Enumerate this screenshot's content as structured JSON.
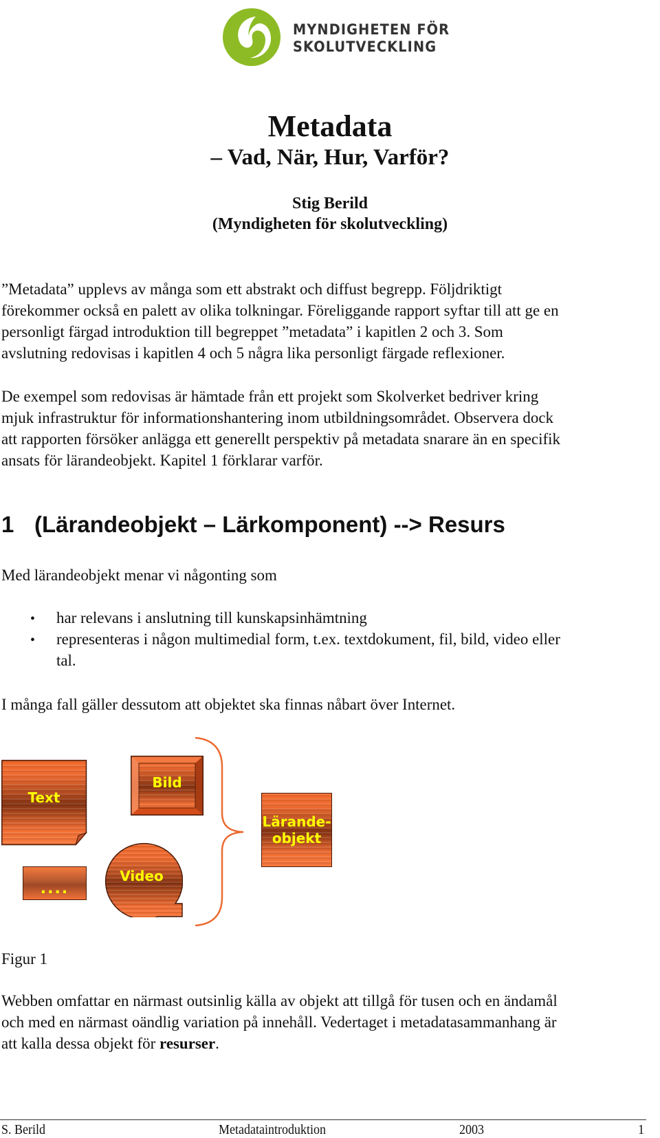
{
  "logo": {
    "icon": "swirl-logo-icon",
    "line1": "MYNDIGHETEN FÖR",
    "line2": "SKOLUTVECKLING",
    "color": "#8dbb25"
  },
  "header": {
    "title": "Metadata",
    "subtitle": "– Vad, När, Hur, Varför?",
    "author": "Stig Berild",
    "affiliation": "(Myndigheten för skolutveckling)"
  },
  "intro": {
    "paragraph1": [
      "”Metadata” upplevs av många som ett abstrakt och diffust begrepp. Följdriktigt",
      "förekommer också en palett av olika tolkningar. Föreliggande rapport syftar till att ge en",
      "personligt färgad introduktion till begreppet ”metadata” i kapitlen 2 och 3. Som",
      "avslutning redovisas i kapitlen 4 och 5 några lika personligt färgade reflexioner."
    ],
    "paragraph2": [
      "De exempel som redovisas är hämtade från ett projekt som Skolverket bedriver kring",
      "mjuk infrastruktur för informationshantering inom utbildningsområdet. Observera dock",
      "att rapporten försöker anlägga ett generellt perspektiv på metadata snarare än en specifik",
      "ansats för lärandeobjekt. Kapitel 1 förklarar varför."
    ]
  },
  "section1": {
    "number": "1",
    "title": "(Lärandeobjekt – Lärkomponent) --> Resurs",
    "lead": "Med lärandeobjekt menar vi någonting som",
    "bullets": [
      {
        "symbol": "•",
        "lines": [
          "har relevans i anslutning till kunskapsinhämtning"
        ]
      },
      {
        "symbol": "•",
        "lines": [
          "representeras i någon multimedial form, t.ex. textdokument, fil, bild, video eller",
          "tal."
        ]
      }
    ],
    "after_list": "I många fall gäller dessutom att objektet ska finnas nåbart över Internet.",
    "figure": {
      "shapes": [
        "Text",
        "Bild",
        "....",
        "Video"
      ],
      "result": [
        "Lärande-",
        "objekt"
      ],
      "connector": "curly-brace",
      "accent_color": "#f26b2e",
      "label_color": "#ffff00",
      "caption": "Figur 1"
    },
    "closing": {
      "lines": [
        "Webben omfattar en närmast outsinlig källa av objekt att tillgå för tusen och en ändamål",
        "och med en närmast oändlig variation på innehåll. Vedertaget i metadatasammanhang är",
        "att kalla dessa objekt för "
      ],
      "bold_term": "resurser",
      "end": "."
    }
  },
  "footer": {
    "author": "S. Berild",
    "doc_title": "Metadataintroduktion",
    "year": "2003",
    "page": "1"
  }
}
